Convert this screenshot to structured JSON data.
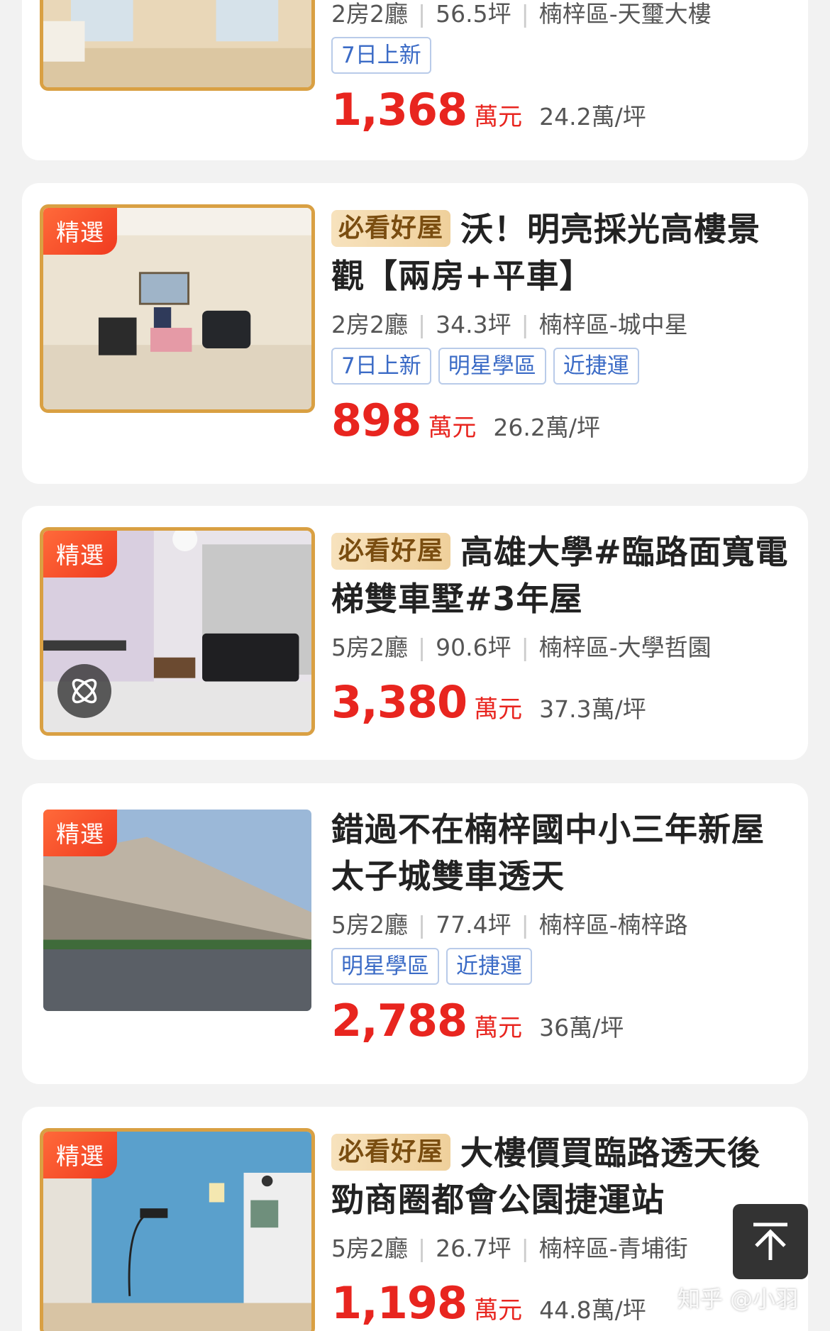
{
  "listings": [
    {
      "featured_badge": "",
      "must_see_tag": "",
      "title": "",
      "rooms": "2房2廳",
      "area": "56.5坪",
      "location": "楠梓區-天璽大樓",
      "tags": [
        "7日上新"
      ],
      "price": "1,368",
      "price_unit": "萬元",
      "price_per_ping": "24.2萬/坪"
    },
    {
      "featured_badge": "精選",
      "must_see_tag": "必看好屋",
      "title": "沃！明亮採光高樓景觀【兩房+平車】",
      "rooms": "2房2廳",
      "area": "34.3坪",
      "location": "楠梓區-城中星",
      "tags": [
        "7日上新",
        "明星學區",
        "近捷運"
      ],
      "price": "898",
      "price_unit": "萬元",
      "price_per_ping": "26.2萬/坪"
    },
    {
      "featured_badge": "精選",
      "must_see_tag": "必看好屋",
      "title": "高雄大學#臨路面寬電梯雙車墅#3年屋",
      "rooms": "5房2廳",
      "area": "90.6坪",
      "location": "楠梓區-大學哲園",
      "tags": [],
      "price": "3,380",
      "price_unit": "萬元",
      "price_per_ping": "37.3萬/坪"
    },
    {
      "featured_badge": "精選",
      "must_see_tag": "",
      "title": "錯過不在楠梓國中小三年新屋太子城雙車透天",
      "rooms": "5房2廳",
      "area": "77.4坪",
      "location": "楠梓區-楠梓路",
      "tags": [
        "明星學區",
        "近捷運"
      ],
      "price": "2,788",
      "price_unit": "萬元",
      "price_per_ping": "36萬/坪"
    },
    {
      "featured_badge": "精選",
      "must_see_tag": "必看好屋",
      "title": "大樓價買臨路透天後勁商圈都會公園捷運站",
      "rooms": "5房2廳",
      "area": "26.7坪",
      "location": "楠梓區-青埔街",
      "tags": [],
      "price": "1,198",
      "price_unit": "萬元",
      "price_per_ping": "44.8萬/坪"
    }
  ],
  "back_to_top_icon": "arrow-up-icon",
  "vr_icon": "vr-atom-icon",
  "watermark": "知乎 @小羽",
  "colors": {
    "price_red": "#e8251f",
    "tag_blue": "#3b6bc6",
    "featured_orange": "#f03a1f",
    "gold_border": "#d9a043"
  }
}
